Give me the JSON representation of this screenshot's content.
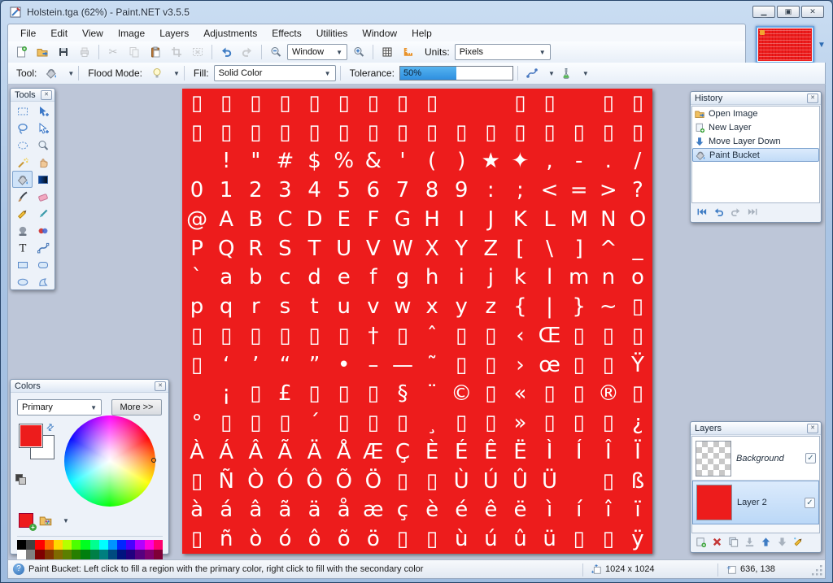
{
  "window": {
    "title": "Holstein.tga (62%) - Paint.NET v3.5.5",
    "controls": [
      "minimize",
      "maximize",
      "close"
    ]
  },
  "menu": {
    "items": [
      "File",
      "Edit",
      "View",
      "Image",
      "Layers",
      "Adjustments",
      "Effects",
      "Utilities",
      "Window",
      "Help"
    ]
  },
  "toolbar": {
    "zoom_value": "Window",
    "units_label": "Units:",
    "units_value": "Pixels"
  },
  "tool_options": {
    "tool_label": "Tool:",
    "flood_label": "Flood Mode:",
    "fill_label": "Fill:",
    "fill_value": "Solid Color",
    "tolerance_label": "Tolerance:",
    "tolerance_value": "50%"
  },
  "tools_panel": {
    "title": "Tools",
    "selected": "Paint Bucket",
    "tools": [
      {
        "name": "Rectangle Select",
        "icon": "rect-select-icon"
      },
      {
        "name": "Move Selected Pixels",
        "icon": "move-pixels-icon"
      },
      {
        "name": "Lasso Select",
        "icon": "lasso-icon"
      },
      {
        "name": "Move Selection",
        "icon": "move-selection-icon"
      },
      {
        "name": "Ellipse Select",
        "icon": "ellipse-select-icon"
      },
      {
        "name": "Zoom",
        "icon": "zoom-tool-icon"
      },
      {
        "name": "Magic Wand",
        "icon": "magic-wand-icon"
      },
      {
        "name": "Pan",
        "icon": "pan-icon"
      },
      {
        "name": "Paint Bucket",
        "icon": "paint-bucket-icon"
      },
      {
        "name": "Gradient",
        "icon": "gradient-icon"
      },
      {
        "name": "Paintbrush",
        "icon": "paintbrush-icon"
      },
      {
        "name": "Eraser",
        "icon": "eraser-icon"
      },
      {
        "name": "Pencil",
        "icon": "pencil-icon"
      },
      {
        "name": "Color Picker",
        "icon": "color-picker-icon"
      },
      {
        "name": "Clone Stamp",
        "icon": "clone-stamp-icon"
      },
      {
        "name": "Recolor",
        "icon": "recolor-icon"
      },
      {
        "name": "Text",
        "icon": "text-tool-icon"
      },
      {
        "name": "Line / Curve",
        "icon": "line-curve-icon"
      },
      {
        "name": "Rectangle",
        "icon": "rectangle-icon"
      },
      {
        "name": "Rounded Rectangle",
        "icon": "rounded-rectangle-icon"
      },
      {
        "name": "Ellipse",
        "icon": "ellipse-icon"
      },
      {
        "name": "Freeform Shape",
        "icon": "freeform-icon"
      }
    ]
  },
  "history_panel": {
    "title": "History",
    "selected_index": 3,
    "items": [
      {
        "label": "Open Image",
        "icon": "open-image-icon"
      },
      {
        "label": "New Layer",
        "icon": "new-layer-icon"
      },
      {
        "label": "Move Layer Down",
        "icon": "move-layer-down-icon"
      },
      {
        "label": "Paint Bucket",
        "icon": "paint-bucket-icon"
      }
    ]
  },
  "colors_panel": {
    "title": "Colors",
    "mode_value": "Primary",
    "more_label": "More >>",
    "primary_color": "#ED1C1C",
    "secondary_color": "#FFFFFF",
    "swatches_top": [
      "#000000",
      "#404040",
      "#FF0000",
      "#FF6A00",
      "#FFD800",
      "#B6FF00",
      "#4CFF00",
      "#00FF21",
      "#00FF90",
      "#00FFFF",
      "#0094FF",
      "#0026FF",
      "#4800FF",
      "#B200FF",
      "#FF00DC",
      "#FF006E"
    ],
    "swatches_bottom": [
      "#FFFFFF",
      "#808080",
      "#7F0000",
      "#7F3300",
      "#7F6A00",
      "#5B7F00",
      "#267F00",
      "#007F0E",
      "#007F46",
      "#007F7F",
      "#004A7F",
      "#00137F",
      "#21007F",
      "#57007F",
      "#7F006E",
      "#7F0037"
    ]
  },
  "layers_panel": {
    "title": "Layers",
    "layers": [
      {
        "name": "Background",
        "thumb": "checker",
        "visible": true,
        "selected": false,
        "italic": true
      },
      {
        "name": "Layer 2",
        "thumb": "red",
        "visible": true,
        "selected": true,
        "italic": false
      }
    ]
  },
  "status_bar": {
    "message": "Paint Bucket: Left click to fill a region with the primary color, right click to fill with the secondary color",
    "image_size": "1024 x 1024",
    "cursor_position": "636, 138"
  },
  "canvas": {
    "color": "#ED1C1C",
    "glyph_rows": [
      [
        "▯",
        "▯",
        "▯",
        "▯",
        "▯",
        "▯",
        "▯",
        "▯",
        "▯",
        "",
        "",
        "▯",
        "▯",
        "",
        "▯",
        "▯"
      ],
      [
        "▯",
        "▯",
        "▯",
        "▯",
        "▯",
        "▯",
        "▯",
        "▯",
        "▯",
        "▯",
        "▯",
        "▯",
        "▯",
        "▯",
        "▯",
        "▯"
      ],
      [
        "",
        "!",
        "\"",
        "#",
        "$",
        "%",
        "&",
        "'",
        "(",
        ")",
        "★",
        "✦",
        ",",
        "-",
        ".",
        "/"
      ],
      [
        "0",
        "1",
        "2",
        "3",
        "4",
        "5",
        "6",
        "7",
        "8",
        "9",
        ":",
        ";",
        "<",
        "=",
        ">",
        "?"
      ],
      [
        "@",
        "A",
        "B",
        "C",
        "D",
        "E",
        "F",
        "G",
        "H",
        "I",
        "J",
        "K",
        "L",
        "M",
        "N",
        "O"
      ],
      [
        "P",
        "Q",
        "R",
        "S",
        "T",
        "U",
        "V",
        "W",
        "X",
        "Y",
        "Z",
        "[",
        "\\",
        "]",
        "^",
        "_"
      ],
      [
        "`",
        "a",
        "b",
        "c",
        "d",
        "e",
        "f",
        "g",
        "h",
        "i",
        "j",
        "k",
        "l",
        "m",
        "n",
        "o"
      ],
      [
        "p",
        "q",
        "r",
        "s",
        "t",
        "u",
        "v",
        "w",
        "x",
        "y",
        "z",
        "{",
        "|",
        "}",
        "~",
        "▯"
      ],
      [
        "▯",
        "▯",
        "▯",
        "▯",
        "▯",
        "▯",
        "†",
        "▯",
        "ˆ",
        "▯",
        "▯",
        "‹",
        "Œ",
        "▯",
        "▯",
        "▯"
      ],
      [
        "▯",
        "‘",
        "’",
        "“",
        "”",
        "•",
        "–",
        "—",
        "˜",
        "▯",
        "▯",
        "›",
        "œ",
        "▯",
        "▯",
        "Ÿ"
      ],
      [
        "",
        "¡",
        "▯",
        "£",
        "▯",
        "▯",
        "▯",
        "§",
        "¨",
        "©",
        "▯",
        "«",
        "▯",
        "▯",
        "®",
        "▯"
      ],
      [
        "°",
        "▯",
        "▯",
        "▯",
        "´",
        "▯",
        "▯",
        "▯",
        "¸",
        "▯",
        "▯",
        "»",
        "▯",
        "▯",
        "▯",
        "¿"
      ],
      [
        "À",
        "Á",
        "Â",
        "Ã",
        "Ä",
        "Å",
        "Æ",
        "Ç",
        "È",
        "É",
        "Ê",
        "Ë",
        "Ì",
        "Í",
        "Î",
        "Ï"
      ],
      [
        "▯",
        "Ñ",
        "Ò",
        "Ó",
        "Ô",
        "Õ",
        "Ö",
        "▯",
        "▯",
        "Ù",
        "Ú",
        "Û",
        "Ü",
        "",
        "▯",
        "ß"
      ],
      [
        "à",
        "á",
        "â",
        "ã",
        "ä",
        "å",
        "æ",
        "ç",
        "è",
        "é",
        "ê",
        "ë",
        "ì",
        "í",
        "î",
        "ï"
      ],
      [
        "▯",
        "ñ",
        "ò",
        "ó",
        "ô",
        "õ",
        "ö",
        "▯",
        "▯",
        "ù",
        "ú",
        "û",
        "ü",
        "▯",
        "▯",
        "ÿ"
      ]
    ]
  }
}
